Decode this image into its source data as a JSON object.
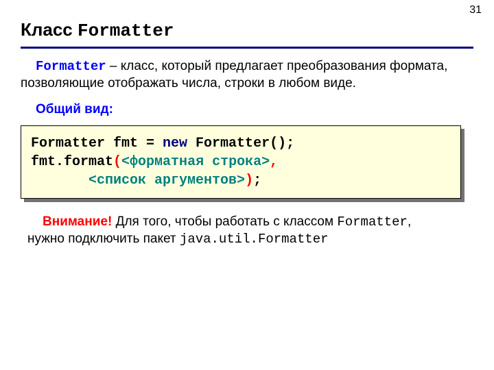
{
  "page_number": "31",
  "title": {
    "prefix": "Класс ",
    "mono": "Formatter"
  },
  "intro": {
    "keyword": "Formatter",
    "rest": " – класс, который предлагает преобразования формата, позволяющие отображать числа, строки в любом виде."
  },
  "section_label": "Общий вид:",
  "code": {
    "line1_a": "Formatter fmt = ",
    "line1_b": "new",
    "line1_c": " Formatter();",
    "line2_a": "fmt.format",
    "line2_b": "(",
    "line2_c": "<форматная строка>",
    "line2_d": ",",
    "line3_pad": "       ",
    "line3_a": "<список аргументов>",
    "line3_b": ")",
    "line3_c": ";"
  },
  "note": {
    "warn": "Внимание!",
    "t1": " Для того, чтобы работать с классом ",
    "cls": "Formatter",
    "t2": ", нужно подключить пакет ",
    "pkg": "java.util.Formatter"
  }
}
